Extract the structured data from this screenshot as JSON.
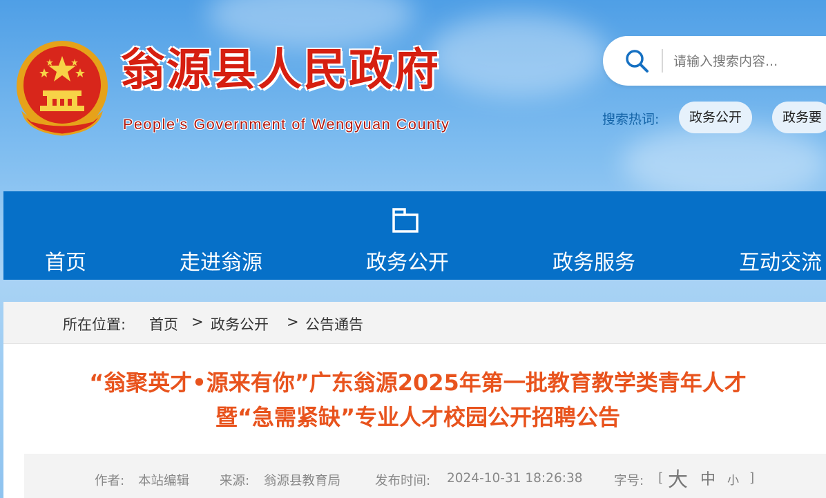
{
  "header": {
    "title_cn": "翁源县人民政府",
    "title_en": "People’s Government of Wengyuan County"
  },
  "search": {
    "placeholder": "请输入搜索内容...",
    "hot_label": "搜索热词:",
    "hot_tags": [
      "政务公开",
      "政务要"
    ]
  },
  "nav": {
    "items": [
      "首页",
      "走进翁源",
      "政务公开",
      "政务服务",
      "互动交流"
    ],
    "active_icon": "folder-icon"
  },
  "breadcrumb": {
    "label": "所在位置:",
    "items": [
      "首页",
      "政务公开",
      "公告通告"
    ],
    "separator": ">"
  },
  "article": {
    "title_line1": "“翁聚英才•源来有你”广东翁源2025年第一批教育教学类青年人才",
    "title_line2": "暨“急需紧缺”专业人才校园公开招聘公告",
    "author_label": "作者:",
    "author": "本站编辑",
    "source_label": "来源:",
    "source": "翁源县教育局",
    "date_label": "发布时间:",
    "date": "2024-10-31 18:26:38",
    "fontsize_label": "字号:",
    "fontsize_open": "[",
    "fontsize_close": "]",
    "fontsize_options": [
      "大",
      "中",
      "小"
    ]
  },
  "colors": {
    "nav_bg": "#0670c8",
    "title_red": "#d61f10",
    "article_title": "#e8531d",
    "hot_label": "#1565a8"
  }
}
